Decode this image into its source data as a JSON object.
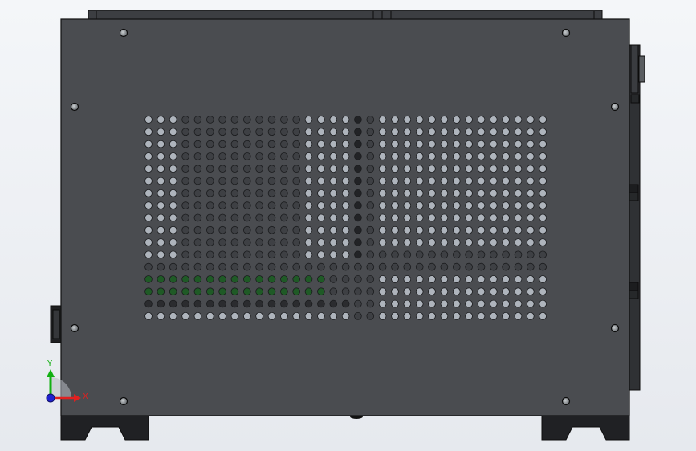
{
  "viewport": {
    "background_top": "#f4f6f9",
    "background_bottom": "#e6e9ee"
  },
  "model": {
    "view": "front",
    "panel_color": "#4a4c50",
    "panel_edge_color": "#101010",
    "hole_light_color": "#aeb4bc",
    "hole_dark_color": "#3e4044",
    "hole_green_color": "#1f5a26",
    "screw_color": "#8e9296"
  },
  "triad": {
    "x_label": "X",
    "y_label": "Y",
    "x_color": "#e02020",
    "y_color": "#12b012",
    "z_color": "#2020d0"
  }
}
